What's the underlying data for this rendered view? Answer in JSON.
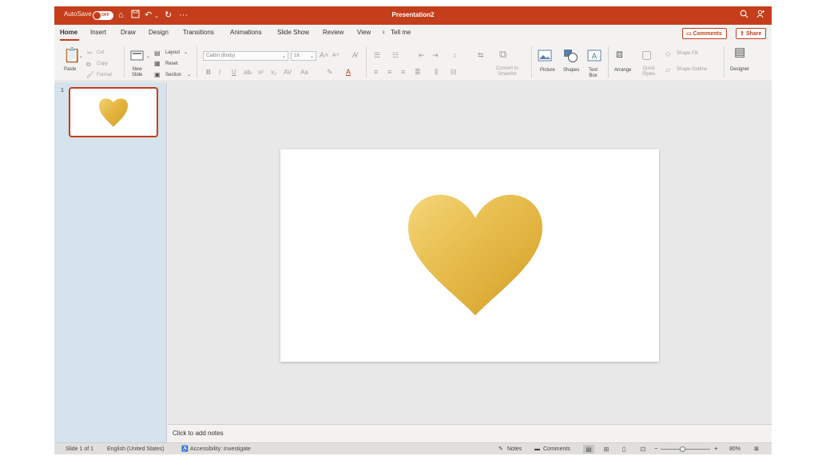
{
  "titlebar": {
    "autosave_label": "AutoSave",
    "autosave_state": "OFF",
    "doc_title": "Presentation2",
    "icons": [
      "home-icon",
      "save-icon",
      "undo-icon",
      "redo-icon",
      "more-icon",
      "search-icon",
      "share-person-icon"
    ]
  },
  "tabs": [
    "Home",
    "Insert",
    "Draw",
    "Design",
    "Transitions",
    "Animations",
    "Slide Show",
    "Review",
    "View"
  ],
  "active_tab": "Home",
  "tell_me": "Tell me",
  "actions": {
    "comments": "Comments",
    "share": "Share"
  },
  "ribbon": {
    "clipboard": {
      "paste": "Paste",
      "cut": "Cut",
      "copy": "Copy",
      "format": "Format"
    },
    "slides": {
      "new_slide": "New\nSlide",
      "layout": "Layout",
      "reset": "Reset",
      "section": "Section"
    },
    "font": {
      "font_name": "Calibri (Body)",
      "font_size": "18",
      "bold": "B",
      "italic": "I",
      "underline": "U",
      "font_color": "A",
      "change_case": "Aa"
    },
    "convert_smartart": "Convert to\nSmartArt",
    "insert": {
      "picture": "Picture",
      "shapes": "Shapes",
      "text_box": "Text\nBox"
    },
    "drawing": {
      "arrange": "Arrange",
      "quick_styles": "Quick\nStyles",
      "shape_fill": "Shape Fill",
      "shape_outline": "Shape Outline"
    },
    "designer": "Designer"
  },
  "slides_panel": {
    "slide_number": "1"
  },
  "slide": {
    "image": "gold-heart",
    "heart_color": "#e2b33c",
    "heart_highlight": "#f5d679",
    "heart_shadow": "#c9962a"
  },
  "notes_placeholder": "Click to add notes",
  "statusbar": {
    "slide_info": "Slide 1 of 1",
    "language": "English (United States)",
    "accessibility": "Accessibility: Investigate",
    "notes": "Notes",
    "comments": "Comments",
    "zoom_out": "−",
    "zoom_in": "+",
    "zoom": "80%",
    "zoom_level_fraction": 0.45
  },
  "colors": {
    "accent": "#c43e1c",
    "panel": "#d4e3ec",
    "canvas": "#e8e8e8"
  }
}
